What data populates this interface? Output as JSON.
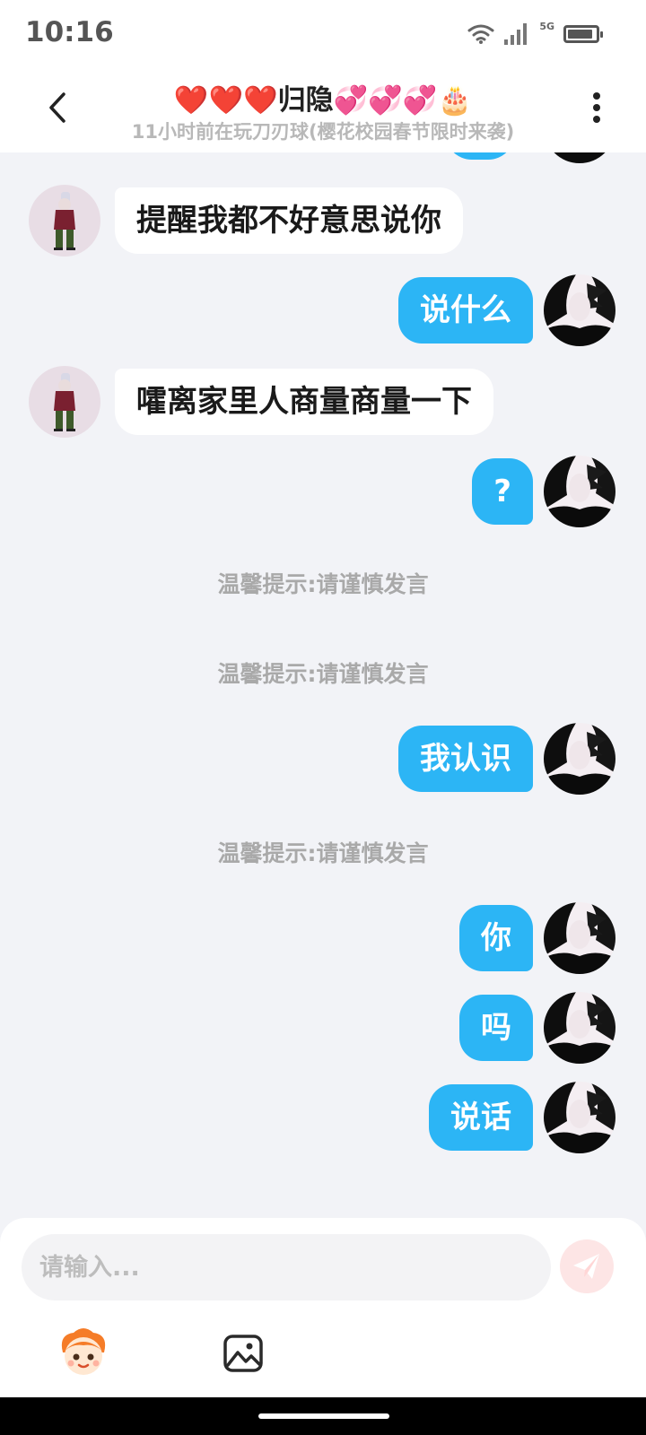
{
  "status_bar": {
    "time": "10:16",
    "network": "5G",
    "battery_level": 0.8
  },
  "header": {
    "title": "❤️❤️❤️归隐💞💞💞🎂",
    "subtitle": "11小时前在玩刀刃球(樱花校园春节限时来袭)"
  },
  "messages": [
    {
      "side": "left",
      "text": "提醒我都不好意思说你"
    },
    {
      "side": "right",
      "text": "说什么"
    },
    {
      "side": "left",
      "text": "嚯离家里人商量商量一下"
    },
    {
      "side": "right",
      "text": "?"
    },
    {
      "side": "system",
      "text": "温馨提示:请谨慎发言"
    },
    {
      "side": "system",
      "text": "温馨提示:请谨慎发言"
    },
    {
      "side": "right",
      "text": "我认识"
    },
    {
      "side": "system",
      "text": "温馨提示:请谨慎发言"
    },
    {
      "side": "right",
      "text": "你"
    },
    {
      "side": "right",
      "text": "吗"
    },
    {
      "side": "right",
      "text": "说话"
    }
  ],
  "composer": {
    "placeholder": "请输入..."
  },
  "icons": {
    "back": "chevron-left-icon",
    "more": "more-vertical-icon",
    "send": "send-icon",
    "emoji": "emoji-mascot-icon",
    "image": "image-icon"
  },
  "colors": {
    "outgoing_bubble": "#2cb5f5",
    "incoming_bubble": "#ffffff",
    "chat_background": "#f2f3f7",
    "notice_text": "#a9a9a9"
  }
}
